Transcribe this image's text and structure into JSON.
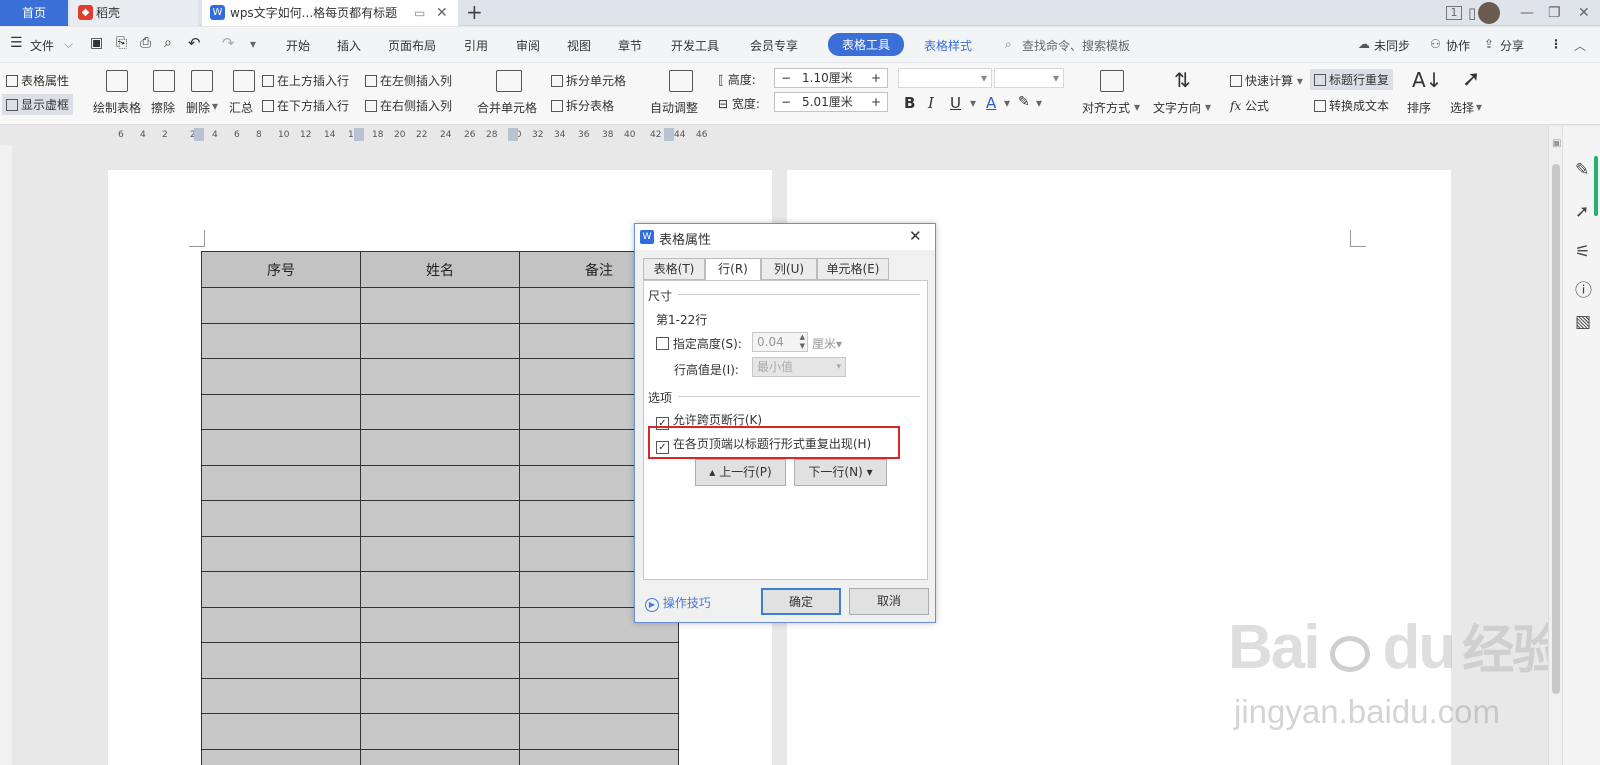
{
  "tabs": {
    "home": "首页",
    "daoke": "稻壳",
    "doc": "wps文字如何...格每页都有标题"
  },
  "menu": {
    "file": "文件",
    "items": [
      "开始",
      "插入",
      "页面布局",
      "引用",
      "审阅",
      "视图",
      "章节",
      "开发工具",
      "会员专享"
    ],
    "table_tools": "表格工具",
    "table_style": "表格样式",
    "search": "查找命令、搜索模板",
    "unsynced": "未同步",
    "collab": "协作",
    "share": "分享"
  },
  "ribbon": {
    "table_props": "表格属性",
    "show_gridlines": "显示虚框",
    "draw_table": "绘制表格",
    "erase": "擦除",
    "delete": "删除",
    "summary": "汇总",
    "insert_above": "在上方插入行",
    "insert_below": "在下方插入行",
    "insert_left": "在左侧插入列",
    "insert_right": "在右侧插入列",
    "merge_cells": "合并单元格",
    "split_cells": "拆分单元格",
    "split_table": "拆分表格",
    "auto_adjust": "自动调整",
    "height_label": "高度:",
    "height_value": "1.10厘米",
    "width_label": "宽度:",
    "width_value": "5.01厘米",
    "align": "对齐方式",
    "text_dir": "文字方向",
    "quick_calc": "快速计算",
    "formula": "公式",
    "repeat_header": "标题行重复",
    "to_text": "转换成文本",
    "sort": "排序",
    "select": "选择"
  },
  "ruler": [
    "6",
    "4",
    "2",
    "2",
    "4",
    "6",
    "8",
    "10",
    "12",
    "14",
    "16",
    "18",
    "20",
    "22",
    "24",
    "26",
    "28",
    "30",
    "32",
    "34",
    "36",
    "38",
    "40",
    "42",
    "44",
    "46"
  ],
  "table": {
    "headers": [
      "序号",
      "姓名",
      "备注"
    ],
    "empty_rows": 14
  },
  "dialog": {
    "title": "表格属性",
    "tabs": [
      "表格(T)",
      "行(R)",
      "列(U)",
      "单元格(E)"
    ],
    "size_group": "尺寸",
    "rows_label": "第1-22行",
    "specify_height": "指定高度(S):",
    "height_value": "0.04",
    "height_unit": "厘米",
    "row_height_is": "行高值是(I):",
    "row_height_mode": "最小值",
    "options_group": "选项",
    "allow_break": "允许跨页断行(K)",
    "repeat_header": "在各页顶端以标题行形式重复出现(H)",
    "prev_row": "上一行(P)",
    "next_row": "下一行(N)",
    "tips": "操作技巧",
    "ok": "确定",
    "cancel": "取消"
  },
  "watermark": {
    "brand": "Bai",
    "brand2": "du",
    "cn": "经验",
    "url": "jingyan.baidu.com"
  },
  "colors": {
    "accent": "#3b6fd8",
    "highlight_box": "#d9262c"
  }
}
